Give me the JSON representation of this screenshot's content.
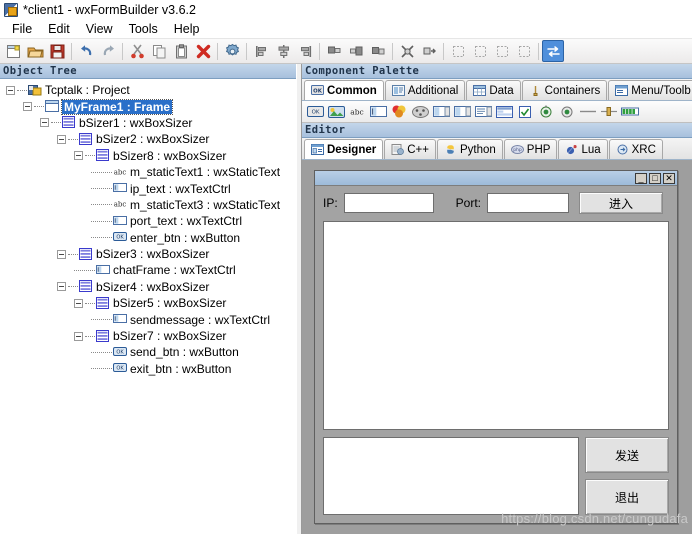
{
  "window": {
    "title": "*client1 - wxFormBuilder v3.6.2",
    "icon": "wxformbuilder-icon"
  },
  "menubar": {
    "items": [
      {
        "label": "File"
      },
      {
        "label": "Edit"
      },
      {
        "label": "View"
      },
      {
        "label": "Tools"
      },
      {
        "label": "Help"
      }
    ]
  },
  "toolbar": {
    "groups": [
      [
        {
          "name": "new-file-icon",
          "tooltip": "New"
        },
        {
          "name": "open-folder-icon",
          "tooltip": "Open"
        },
        {
          "name": "save-icon",
          "tooltip": "Save"
        }
      ],
      [
        {
          "name": "undo-icon",
          "tooltip": "Undo"
        },
        {
          "name": "redo-icon",
          "tooltip": "Redo"
        }
      ],
      [
        {
          "name": "cut-scissors-icon",
          "tooltip": "Cut"
        },
        {
          "name": "copy-icon",
          "tooltip": "Copy"
        },
        {
          "name": "paste-clipboard-icon",
          "tooltip": "Paste"
        },
        {
          "name": "delete-x-icon",
          "tooltip": "Delete"
        }
      ],
      [
        {
          "name": "generate-code-gear-icon",
          "tooltip": "Generate Code"
        }
      ],
      [
        {
          "name": "align-left-icon",
          "tooltip": "Align Left"
        },
        {
          "name": "align-center-icon",
          "tooltip": "Align Center"
        },
        {
          "name": "align-right-icon",
          "tooltip": "Align Right"
        }
      ],
      [
        {
          "name": "align-top-icon",
          "tooltip": "Align Top"
        },
        {
          "name": "align-middle-icon",
          "tooltip": "Align Middle"
        },
        {
          "name": "align-bottom-icon",
          "tooltip": "Align Bottom"
        }
      ],
      [
        {
          "name": "expand-icon",
          "tooltip": "Expand"
        },
        {
          "name": "stretch-icon",
          "tooltip": "Stretch"
        }
      ],
      [
        {
          "name": "border-left-icon",
          "tooltip": "Border Left"
        },
        {
          "name": "border-right-icon",
          "tooltip": "Border Right"
        },
        {
          "name": "border-top-icon",
          "tooltip": "Border Top"
        },
        {
          "name": "border-bottom-icon",
          "tooltip": "Border Bottom"
        }
      ],
      [
        {
          "name": "toggle-orientation-icon",
          "tooltip": "Orientation",
          "active": true
        }
      ]
    ]
  },
  "object_tree": {
    "caption": "Object Tree",
    "nodes": [
      {
        "label": "Tcptalk : Project",
        "depth": 0,
        "icon": "project-icon",
        "expander": true,
        "selected": false
      },
      {
        "label": "MyFrame1 : Frame",
        "depth": 1,
        "icon": "frame-icon",
        "expander": true,
        "selected": true
      },
      {
        "label": "bSizer1 : wxBoxSizer",
        "depth": 2,
        "icon": "boxsizer-icon",
        "expander": true,
        "selected": false
      },
      {
        "label": "bSizer2 : wxBoxSizer",
        "depth": 3,
        "icon": "boxsizer-icon",
        "expander": true,
        "selected": false
      },
      {
        "label": "bSizer8 : wxBoxSizer",
        "depth": 4,
        "icon": "boxsizer-icon",
        "expander": true,
        "selected": false
      },
      {
        "label": "m_staticText1 : wxStaticText",
        "depth": 5,
        "icon": "statictext-icon",
        "expander": false,
        "selected": false
      },
      {
        "label": "ip_text : wxTextCtrl",
        "depth": 5,
        "icon": "textctrl-icon",
        "expander": false,
        "selected": false
      },
      {
        "label": "m_staticText3 : wxStaticText",
        "depth": 5,
        "icon": "statictext-icon",
        "expander": false,
        "selected": false
      },
      {
        "label": "port_text : wxTextCtrl",
        "depth": 5,
        "icon": "textctrl-icon",
        "expander": false,
        "selected": false
      },
      {
        "label": "enter_btn : wxButton",
        "depth": 5,
        "icon": "button-icon",
        "expander": false,
        "selected": false
      },
      {
        "label": "bSizer3 : wxBoxSizer",
        "depth": 3,
        "icon": "boxsizer-icon",
        "expander": true,
        "selected": false
      },
      {
        "label": "chatFrame : wxTextCtrl",
        "depth": 4,
        "icon": "textctrl-icon",
        "expander": false,
        "selected": false
      },
      {
        "label": "bSizer4 : wxBoxSizer",
        "depth": 3,
        "icon": "boxsizer-icon",
        "expander": true,
        "selected": false
      },
      {
        "label": "bSizer5 : wxBoxSizer",
        "depth": 4,
        "icon": "boxsizer-icon",
        "expander": true,
        "selected": false
      },
      {
        "label": "sendmessage : wxTextCtrl",
        "depth": 5,
        "icon": "textctrl-icon",
        "expander": false,
        "selected": false
      },
      {
        "label": "bSizer7 : wxBoxSizer",
        "depth": 4,
        "icon": "boxsizer-icon",
        "expander": true,
        "selected": false
      },
      {
        "label": "send_btn : wxButton",
        "depth": 5,
        "icon": "button-icon",
        "expander": false,
        "selected": false
      },
      {
        "label": "exit_btn : wxButton",
        "depth": 5,
        "icon": "button-icon",
        "expander": false,
        "selected": false
      }
    ]
  },
  "component_palette": {
    "caption": "Component Palette",
    "tabs": [
      {
        "label": "Common",
        "icon": "button-icon",
        "selected": true
      },
      {
        "label": "Additional",
        "icon": "additional-icon",
        "selected": false
      },
      {
        "label": "Data",
        "icon": "grid-icon",
        "selected": false
      },
      {
        "label": "Containers",
        "icon": "container-icon",
        "selected": false
      },
      {
        "label": "Menu/Toolb",
        "icon": "menubar-icon",
        "selected": false
      }
    ],
    "icons": [
      {
        "name": "wxbutton-icon"
      },
      {
        "name": "wxbitmapbutton-icon"
      },
      {
        "name": "wxstatictext-icon"
      },
      {
        "name": "wxtextctrl-icon"
      },
      {
        "name": "wxstaticbitmap-icon"
      },
      {
        "name": "wxcombobox-icon"
      },
      {
        "name": "wxchoice-icon"
      },
      {
        "name": "wxspinctrl-icon"
      },
      {
        "name": "wxlistbox-icon"
      },
      {
        "name": "wxlistctrl-icon"
      },
      {
        "name": "wxcheckbox-icon"
      },
      {
        "name": "wxradiobutton-icon"
      },
      {
        "name": "wxtogglebutton-icon"
      },
      {
        "name": "wxstaticline-icon"
      },
      {
        "name": "wxslider-icon"
      },
      {
        "name": "wxgauge-icon"
      }
    ]
  },
  "editor": {
    "caption": "Editor",
    "tabs": [
      {
        "label": "Designer",
        "icon": "designer-icon",
        "selected": true
      },
      {
        "label": "C++",
        "icon": "cpp-icon",
        "selected": false
      },
      {
        "label": "Python",
        "icon": "python-icon",
        "selected": false
      },
      {
        "label": "PHP",
        "icon": "php-icon",
        "selected": false
      },
      {
        "label": "Lua",
        "icon": "lua-icon",
        "selected": false
      },
      {
        "label": "XRC",
        "icon": "xrc-icon",
        "selected": false
      }
    ]
  },
  "designer": {
    "mock_window": {
      "titlebar_buttons": [
        {
          "name": "minimize-button",
          "glyph": "_"
        },
        {
          "name": "maximize-button",
          "glyph": "□"
        },
        {
          "name": "close-button",
          "glyph": "✕"
        }
      ],
      "ip_label": "IP:",
      "ip_value": "",
      "port_label": "Port:",
      "port_value": "",
      "enter_button": "进入",
      "chat_value": "",
      "message_value": "",
      "send_button": "发送",
      "exit_button": "退出"
    },
    "watermark": "https://blog.csdn.net/cungudafa"
  },
  "colors": {
    "caption_bar": "#a7c0dd",
    "tree_selection": "#2a6fc9",
    "canvas_background": "#9e9e9e",
    "mock_window_face": "#a3a3a3",
    "toolbar_active": "#4f8fdb"
  }
}
